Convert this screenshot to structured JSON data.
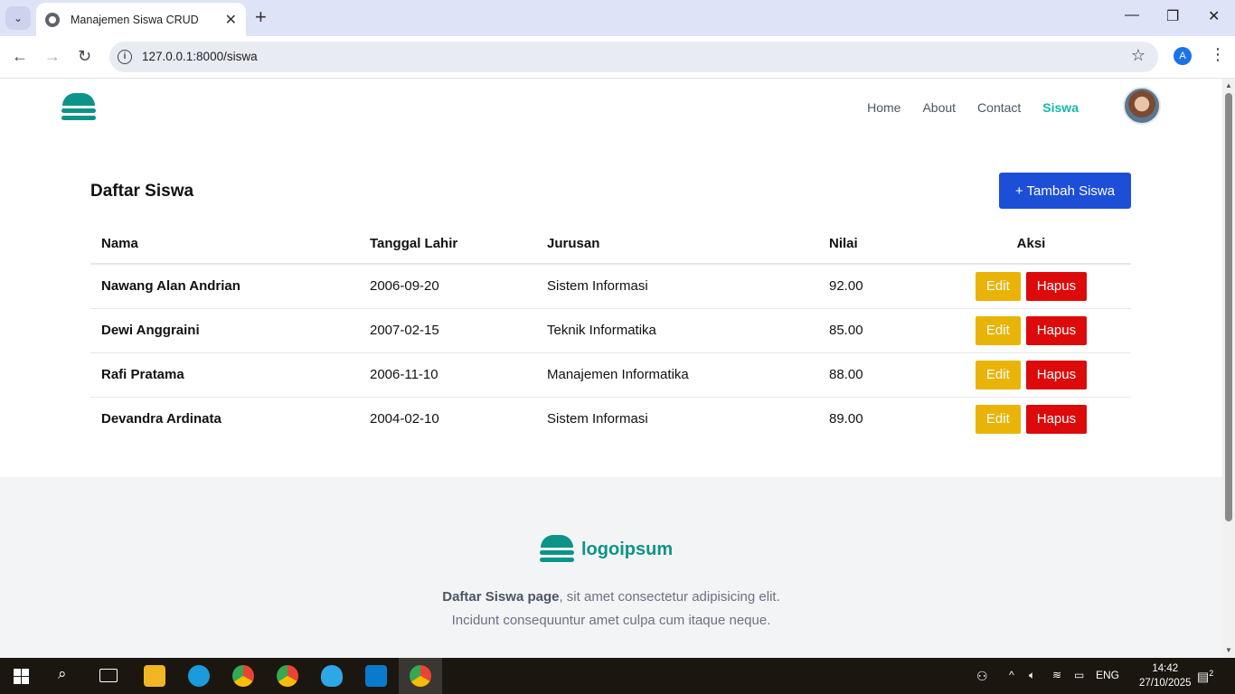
{
  "browser": {
    "tab_title": "Manajemen Siswa CRUD",
    "url": "127.0.0.1:8000/siswa",
    "profile_initial": "A"
  },
  "nav": {
    "items": [
      "Home",
      "About",
      "Contact",
      "Siswa"
    ],
    "active": "Siswa"
  },
  "main": {
    "heading": "Daftar Siswa",
    "add_button": "+ Tambah Siswa",
    "columns": [
      "Nama",
      "Tanggal Lahir",
      "Jurusan",
      "Nilai",
      "Aksi"
    ],
    "rows": [
      {
        "nama": "Nawang Alan Andrian",
        "tanggal_lahir": "2006-09-20",
        "jurusan": "Sistem Informasi",
        "nilai": "92.00"
      },
      {
        "nama": "Dewi Anggraini",
        "tanggal_lahir": "2007-02-15",
        "jurusan": "Teknik Informatika",
        "nilai": "85.00"
      },
      {
        "nama": "Rafi Pratama",
        "tanggal_lahir": "2006-11-10",
        "jurusan": "Manajemen Informatika",
        "nilai": "88.00"
      },
      {
        "nama": "Devandra Ardinata",
        "tanggal_lahir": "2004-02-10",
        "jurusan": "Sistem Informasi",
        "nilai": "89.00"
      }
    ],
    "edit_label": "Edit",
    "delete_label": "Hapus"
  },
  "footer": {
    "logo_text": "logoipsum",
    "text_bold": "Daftar Siswa page",
    "text_rest": ", sit amet consectetur adipisicing elit.",
    "text_line2": "Incidunt consequuntur amet culpa cum itaque neque."
  },
  "taskbar": {
    "language": "ENG",
    "time": "14:42",
    "date": "27/10/2025",
    "notifications": "2"
  },
  "colors": {
    "brand": "#0d9488",
    "nav_active": "#14b8a6",
    "primary_button": "#1d4ed8",
    "edit_button": "#eab308",
    "delete_button": "#dc0a0a"
  }
}
